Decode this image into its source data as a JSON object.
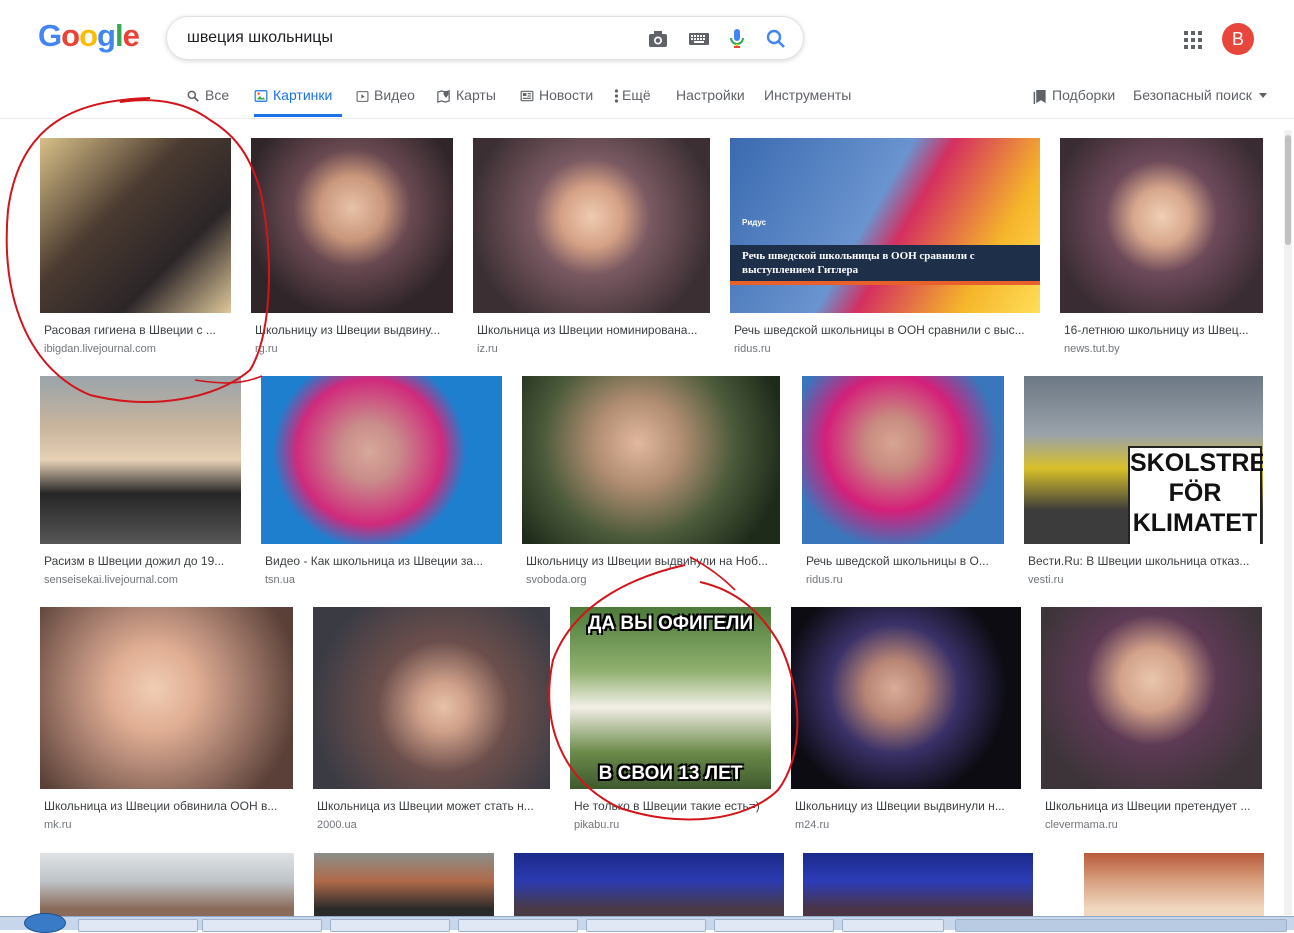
{
  "header": {
    "logo_letters": [
      {
        "ch": "G",
        "color": "#4285f4"
      },
      {
        "ch": "o",
        "color": "#ea4335"
      },
      {
        "ch": "o",
        "color": "#fbbc05"
      },
      {
        "ch": "g",
        "color": "#4285f4"
      },
      {
        "ch": "l",
        "color": "#34a853"
      },
      {
        "ch": "e",
        "color": "#ea4335"
      }
    ],
    "search_query": "швеция школьницы",
    "avatar_letter": "B",
    "avatar_color": "#e8453c"
  },
  "tabs": [
    {
      "label": "Все",
      "icon": "search-icon"
    },
    {
      "label": "Картинки",
      "icon": "image-icon",
      "active": true
    },
    {
      "label": "Видео",
      "icon": "video-icon"
    },
    {
      "label": "Карты",
      "icon": "map-icon"
    },
    {
      "label": "Новости",
      "icon": "news-icon"
    },
    {
      "label": "Ещё",
      "icon": "more-vert-icon"
    },
    {
      "label": "Настройки"
    },
    {
      "label": "Инструменты"
    }
  ],
  "right_tools": {
    "collections_label": "Подборки",
    "safesearch_label": "Безопасный поиск"
  },
  "results": [
    {
      "title": "Расовая гигиена в Швеции с ...",
      "source": "ibigdan.livejournal.com"
    },
    {
      "title": "Школьницу из Швеции выдвину...",
      "source": "rg.ru"
    },
    {
      "title": "Школьница из Швеции номинирована...",
      "source": "iz.ru"
    },
    {
      "title": "Речь шведской школьницы в ООН сравнили с выс...",
      "source": "ridus.ru",
      "image_caption": "Речь шведской школьницы в ООН сравнили с выступлением Гитлера",
      "image_badge": "Ридус"
    },
    {
      "title": "16-летнюю школьницу из Швец...",
      "source": "news.tut.by"
    },
    {
      "title": "Расизм в Швеции дожил до 19...",
      "source": "senseisekai.livejournal.com"
    },
    {
      "title": "Видео - Как школьница из Швеции за...",
      "source": "tsn.ua"
    },
    {
      "title": "Школьницу из Швеции выдвинули на Ноб...",
      "source": "svoboda.org"
    },
    {
      "title": "Речь шведской школьницы в О...",
      "source": "ridus.ru"
    },
    {
      "title": "Вести.Ru: В Швеции школьница отказ...",
      "source": "vesti.ru",
      "sign_lines": [
        "SKOLSTREJK",
        "FÖR",
        "KLIMATET"
      ]
    },
    {
      "title": "Школьница из Швеции обвинила ООН в...",
      "source": "mk.ru"
    },
    {
      "title": "Школьница из Швеции может стать н...",
      "source": "2000.ua"
    },
    {
      "title": "Не только в Швеции такие есть=)",
      "source": "pikabu.ru",
      "meme_top": "ДА ВЫ ОФИГЕЛИ",
      "meme_bottom": "В СВОИ 13 ЛЕТ"
    },
    {
      "title": "Школьницу из Швеции выдвинули н...",
      "source": "m24.ru"
    },
    {
      "title": "Школьница из Швеции претендует ...",
      "source": "clevermama.ru"
    },
    {
      "title": "",
      "source": ""
    },
    {
      "title": "",
      "source": ""
    },
    {
      "title": "",
      "source": ""
    },
    {
      "title": "",
      "source": ""
    },
    {
      "title": "",
      "source": ""
    }
  ],
  "colors": {
    "accent": "#1a73e8",
    "annotation_red": "#d3141b"
  }
}
